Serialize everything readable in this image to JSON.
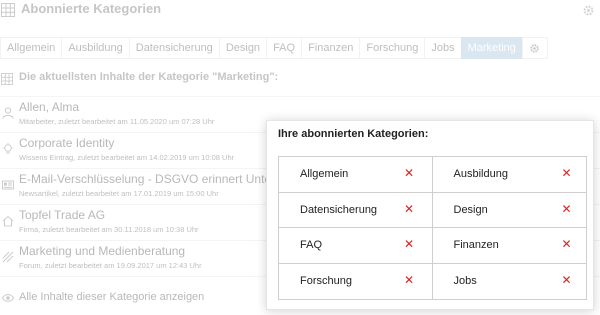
{
  "header": {
    "title": "Abonnierte Kategorien",
    "icon": "grid-icon",
    "settings_icon": "gear-icon"
  },
  "tabs": [
    {
      "label": "Allgemein",
      "active": false
    },
    {
      "label": "Ausbildung",
      "active": false
    },
    {
      "label": "Datensicherung",
      "active": false
    },
    {
      "label": "Design",
      "active": false
    },
    {
      "label": "FAQ",
      "active": false
    },
    {
      "label": "Finanzen",
      "active": false
    },
    {
      "label": "Forschung",
      "active": false
    },
    {
      "label": "Jobs",
      "active": false
    },
    {
      "label": "Marketing",
      "active": true
    }
  ],
  "tab_settings_icon": "gear-icon",
  "section": {
    "title": "Die aktuellsten Inhalte der Kategorie \"Marketing\":",
    "icon": "grid-icon"
  },
  "items": [
    {
      "title": "Allen, Alma",
      "meta": "Mitarbeiter, zuletzt bearbeitet am 11.05.2020 um 07:28 Uhr",
      "icon": "user-icon"
    },
    {
      "title": "Corporate Identity",
      "meta": "Wissens Eintrag, zuletzt bearbeitet am 14.02.2019 um 10:08 Uhr",
      "icon": "lightbulb-icon"
    },
    {
      "title": "E-Mail-Verschlüsselung - DSGVO erinnert Unternehmen",
      "meta": "Newsartikel, zuletzt bearbeitet am 17.01.2019 um 15:00 Uhr",
      "icon": "newspaper-icon"
    },
    {
      "title": "Topfel Trade AG",
      "meta": "Firma, zuletzt bearbeitet am 30.11.2018 um 10:38 Uhr",
      "icon": "home-icon"
    },
    {
      "title": "Marketing und Medienberatung",
      "meta": "Forum, zuletzt bearbeitet am 19.09.2017 um 12:43 Uhr",
      "icon": "forum-icon"
    }
  ],
  "show_all": {
    "label": "Alle Inhalte dieser Kategorie anzeigen",
    "icon": "eye-icon"
  },
  "popover": {
    "title": "Ihre abonnierten Kategorien:",
    "remove_symbol": "✕",
    "remove_color": "#dd2222",
    "categories": [
      "Allgemein",
      "Ausbildung",
      "Datensicherung",
      "Design",
      "FAQ",
      "Finanzen",
      "Forschung",
      "Jobs"
    ]
  },
  "colors": {
    "active_tab": "#a9c4dc",
    "text": "#555555"
  }
}
